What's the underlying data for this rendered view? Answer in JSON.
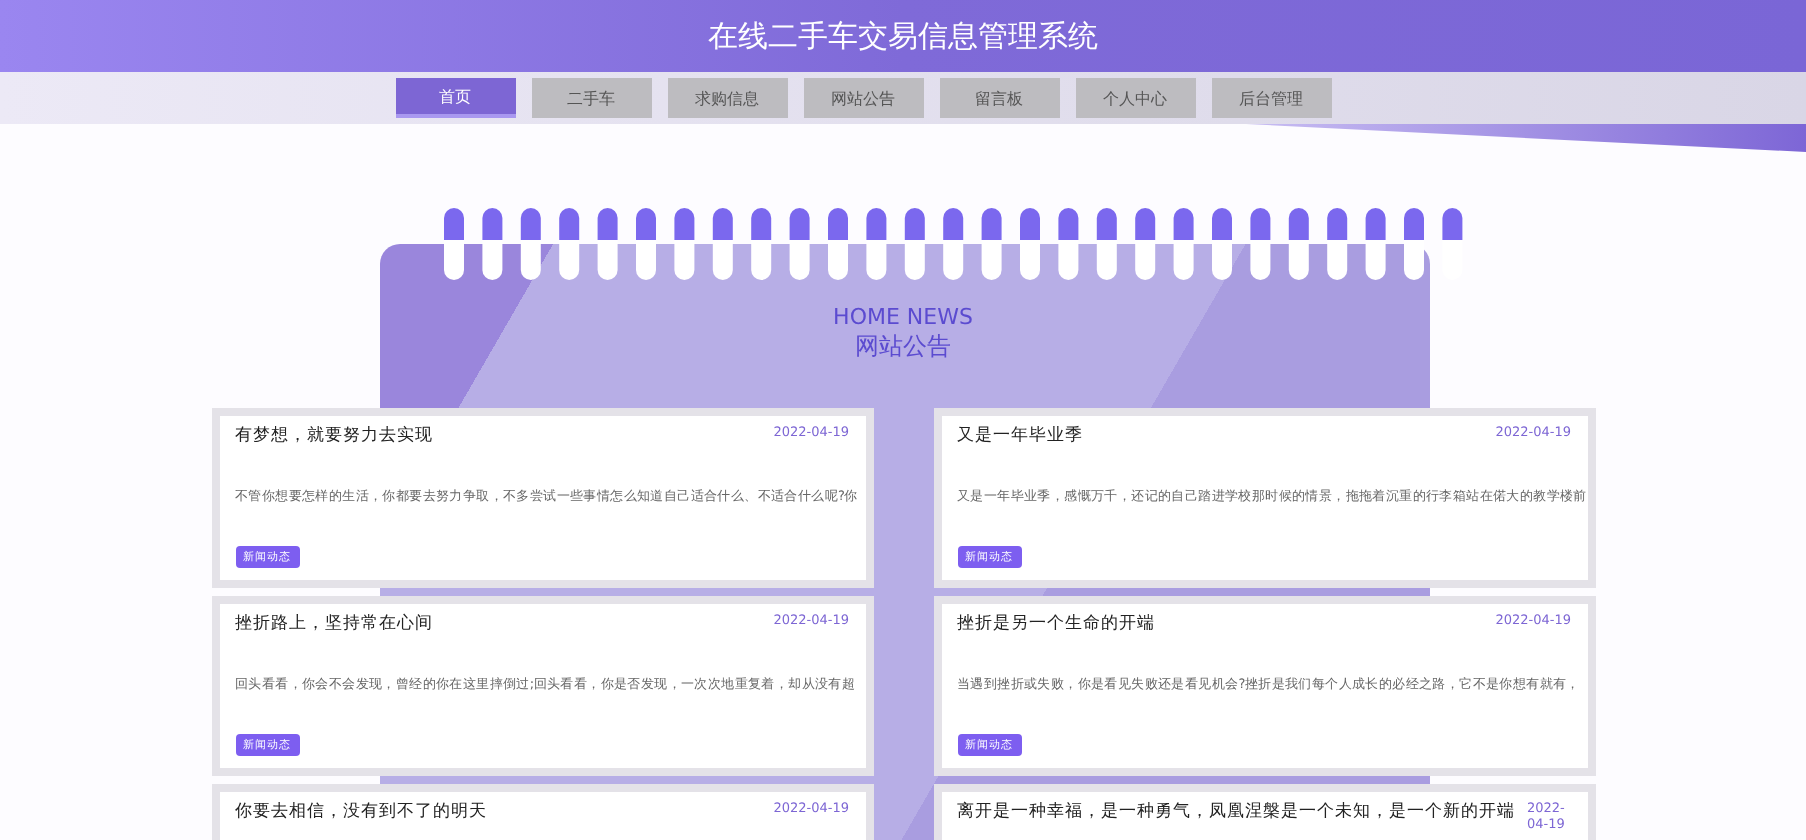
{
  "header": {
    "title": "在线二手车交易信息管理系统"
  },
  "nav": [
    {
      "label": "首页",
      "selected": true
    },
    {
      "label": "二手车",
      "selected": false
    },
    {
      "label": "求购信息",
      "selected": false
    },
    {
      "label": "网站公告",
      "selected": false
    },
    {
      "label": "留言板",
      "selected": false
    },
    {
      "label": "个人中心",
      "selected": false
    },
    {
      "label": "后台管理",
      "selected": false
    }
  ],
  "section": {
    "title_en": "HOME NEWS",
    "title": "网站公告"
  },
  "news": [
    {
      "title": "有梦想，就要努力去实现",
      "date": "2022-04-19",
      "summary": "不管你想要怎样的生活，你都要去努力争取，不多尝试一些事情怎么知道自己适合什么、不适合什么呢?你",
      "tag": "新闻动态"
    },
    {
      "title": "又是一年毕业季",
      "date": "2022-04-19",
      "summary": "又是一年毕业季，感慨万千，还记的自己踏进学校那时候的情景，拖拖着沉重的行李箱站在偌大的教学楼前",
      "tag": "新闻动态"
    },
    {
      "title": "挫折路上，坚持常在心间",
      "date": "2022-04-19",
      "summary": "回头看看，你会不会发现，曾经的你在这里摔倒过;回头看看，你是否发现，一次次地重复着，却从没有超",
      "tag": "新闻动态"
    },
    {
      "title": "挫折是另一个生命的开端",
      "date": "2022-04-19",
      "summary": "当遇到挫折或失败，你是看见失败还是看见机会?挫折是我们每个人成长的必经之路，它不是你想有就有，",
      "tag": "新闻动态"
    },
    {
      "title": "你要去相信，没有到不了的明天",
      "date": "2022-04-19"
    },
    {
      "title": "离开是一种幸福，是一种勇气，凤凰涅槃是一个未知，是一个新的开端",
      "date": "2022-04-19"
    }
  ]
}
